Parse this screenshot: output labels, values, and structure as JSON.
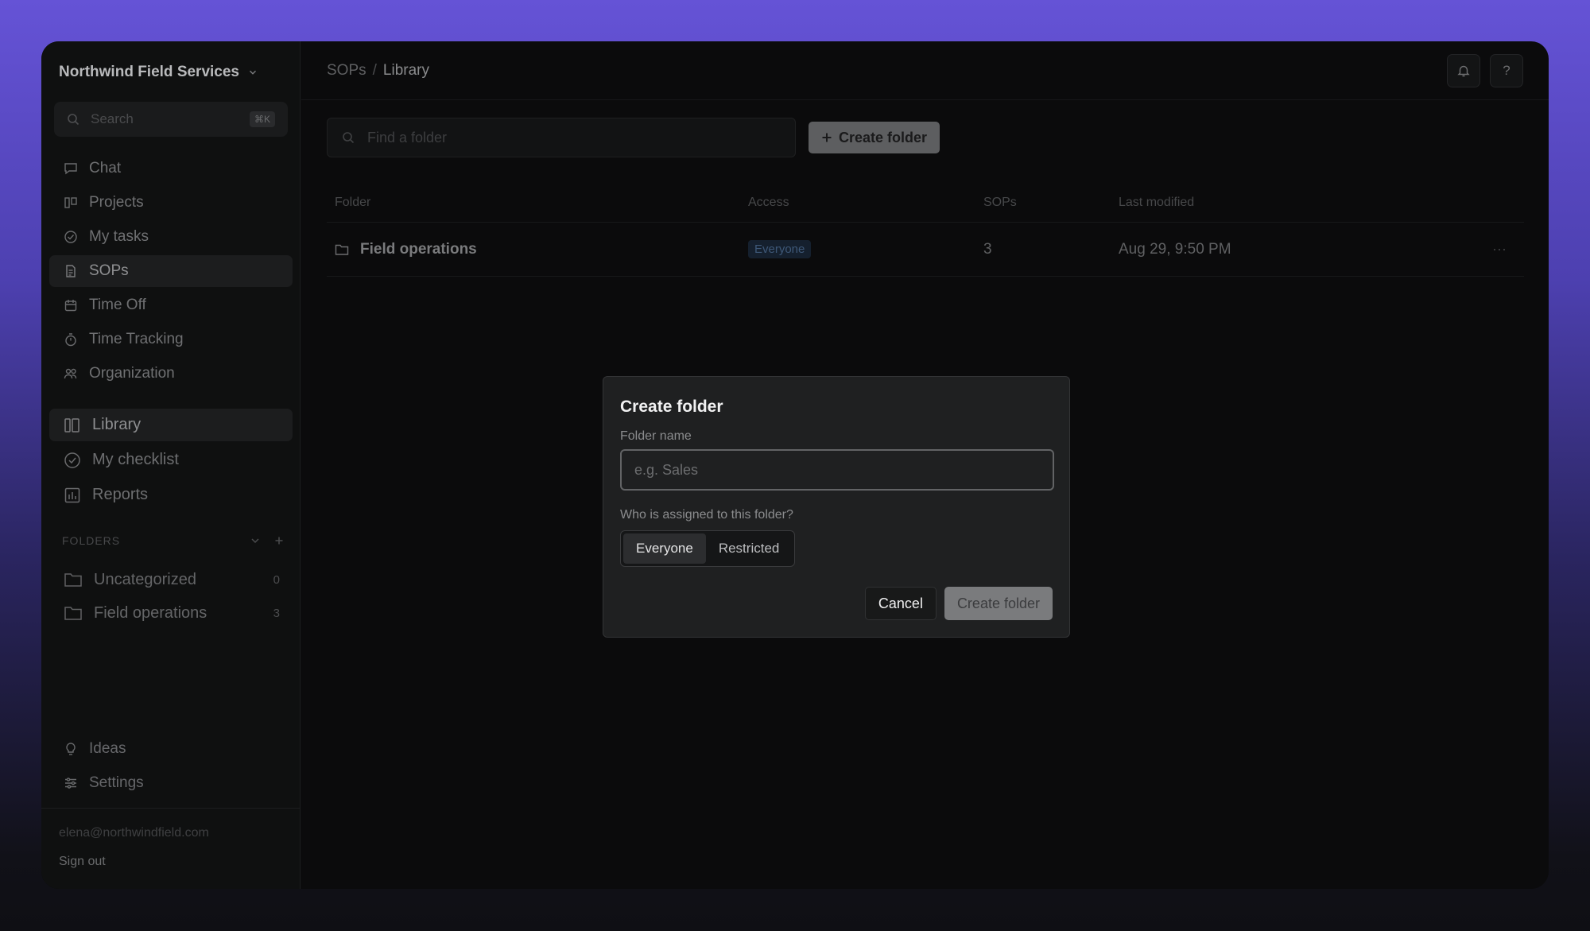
{
  "sidebar": {
    "org_name": "Northwind Field Services",
    "search_placeholder": "Search",
    "search_shortcut": "⌘K",
    "primary_nav": [
      {
        "label": "Chat",
        "icon": "chat-icon"
      },
      {
        "label": "Projects",
        "icon": "projects-icon"
      },
      {
        "label": "My tasks",
        "icon": "check-circle-icon"
      },
      {
        "label": "SOPs",
        "icon": "document-icon",
        "active": true
      },
      {
        "label": "Time Off",
        "icon": "calendar-icon"
      },
      {
        "label": "Time Tracking",
        "icon": "stopwatch-icon"
      },
      {
        "label": "Organization",
        "icon": "people-icon"
      }
    ],
    "sop_nav": [
      {
        "label": "Library",
        "icon": "library-icon",
        "active": true
      },
      {
        "label": "My checklist",
        "icon": "check-circle-icon"
      },
      {
        "label": "Reports",
        "icon": "report-icon"
      }
    ],
    "folders_heading": "FOLDERS",
    "folders": [
      {
        "label": "Uncategorized",
        "count": "0"
      },
      {
        "label": "Field operations",
        "count": "3"
      }
    ],
    "bottom_nav": [
      {
        "label": "Ideas",
        "icon": "lightbulb-icon"
      },
      {
        "label": "Settings",
        "icon": "sliders-icon"
      }
    ],
    "account_email": "elena@northwindfield.com",
    "sign_out": "Sign out"
  },
  "header": {
    "breadcrumb": [
      "SOPs",
      "Library"
    ],
    "breadcrumb_sep": "/",
    "help_label": "?"
  },
  "toolbar": {
    "find_placeholder": "Find a folder",
    "create_label": "Create folder"
  },
  "table": {
    "columns": [
      "Folder",
      "Access",
      "SOPs",
      "Last modified"
    ],
    "rows": [
      {
        "folder": "Field operations",
        "access": "Everyone",
        "sops": "3",
        "modified": "Aug 29, 9:50 PM",
        "more": "···"
      }
    ]
  },
  "modal": {
    "title": "Create folder",
    "name_label": "Folder name",
    "name_placeholder": "e.g. Sales",
    "assign_label": "Who is assigned to this folder?",
    "options": [
      "Everyone",
      "Restricted"
    ],
    "selected_option": "Everyone",
    "cancel_label": "Cancel",
    "submit_label": "Create folder"
  },
  "colors": {
    "background_top": "#6553d6",
    "window": "#0b0b0c",
    "modal": "#1f2021",
    "access_badge": "#15202e"
  }
}
